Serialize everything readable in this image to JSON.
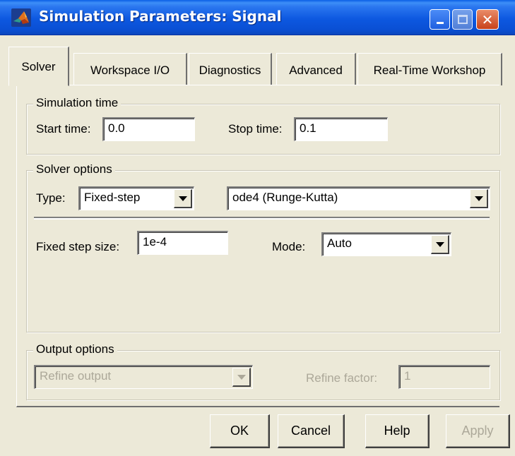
{
  "window": {
    "title": "Simulation Parameters: Signal",
    "controls": {
      "minimize": "minimize-icon",
      "maximize": "maximize-icon",
      "close": "close-icon"
    }
  },
  "tabs": [
    {
      "label": "Solver",
      "active": true
    },
    {
      "label": "Workspace I/O",
      "active": false
    },
    {
      "label": "Diagnostics",
      "active": false
    },
    {
      "label": "Advanced",
      "active": false
    },
    {
      "label": "Real-Time Workshop",
      "active": false
    }
  ],
  "simulation_time": {
    "group_label": "Simulation time",
    "start_label": "Start time:",
    "start_value": "0.0",
    "stop_label": "Stop time:",
    "stop_value": "0.1"
  },
  "solver_options": {
    "group_label": "Solver options",
    "type_label": "Type:",
    "type_value": "Fixed-step",
    "solver_value": "ode4 (Runge-Kutta)",
    "step_label": "Fixed step size:",
    "step_value": "1e-4",
    "mode_label": "Mode:",
    "mode_value": "Auto"
  },
  "output_options": {
    "group_label": "Output options",
    "output_value": "Refine output",
    "refine_label": "Refine factor:",
    "refine_value": "1"
  },
  "buttons": {
    "ok": "OK",
    "cancel": "Cancel",
    "help": "Help",
    "apply": "Apply"
  },
  "colors": {
    "titlebar": "#0d58e0",
    "dialog_bg": "#ece9d8",
    "disabled_text": "#aca899",
    "close_button": "#c8421b"
  }
}
